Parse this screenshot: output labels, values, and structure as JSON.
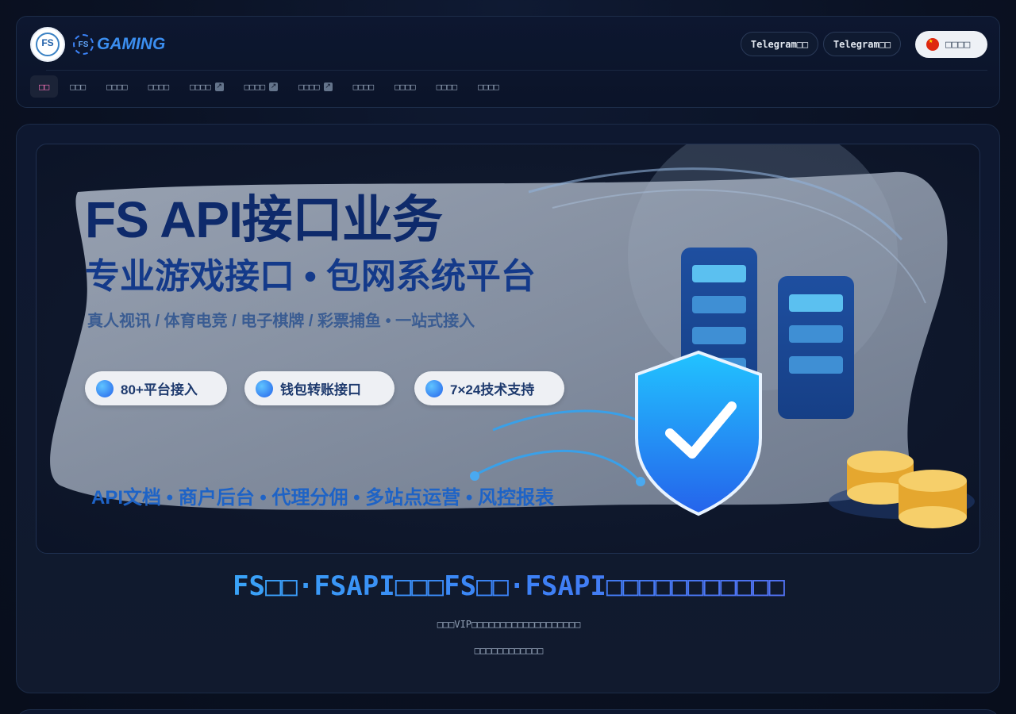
{
  "header": {
    "logo_text": "FS",
    "brand_mark": "FS",
    "brand_word": "GAMING",
    "telegram_buttons": [
      "Telegram□□",
      "Telegram□□"
    ],
    "language_label": "□□□□",
    "language_flag": "china-flag-icon"
  },
  "nav": {
    "items": [
      {
        "label": "□□",
        "active": true,
        "external": false
      },
      {
        "label": "□□□",
        "external": false
      },
      {
        "label": "□□□□",
        "external": false
      },
      {
        "label": "□□□□",
        "external": false
      },
      {
        "label": "□□□□",
        "external": true
      },
      {
        "label": "□□□□",
        "external": true
      },
      {
        "label": "□□□□",
        "external": true
      },
      {
        "label": "□□□□",
        "external": false
      },
      {
        "label": "□□□□",
        "external": false
      },
      {
        "label": "□□□□",
        "external": false
      },
      {
        "label": "□□□□",
        "external": false
      }
    ],
    "external_icon": "↗"
  },
  "banner": {
    "title": "FS API接口业务",
    "subtitle": "专业游戏接口 • 包网系统平台",
    "categories": "真人视讯 / 体育电竞 / 电子棋牌 / 彩票捕鱼 • 一站式接入",
    "pills": [
      "80+平台接入",
      "钱包转账接口",
      "7×24技术支持"
    ],
    "bottom_line": "API文档 • 商户后台 • 代理分佣 • 多站点运营 • 风控报表"
  },
  "hero": {
    "title": "FS□□·FSAPI□□□FS□□·FSAPI□□□□□□□□□□□",
    "line1": "□□□VIP□□□□□□□□□□□□□□□□□□□",
    "line2": "□□□□□□□□□□□□"
  },
  "colors": {
    "accent": "#3b82f6",
    "nav_active": "#f472b6",
    "background": "#0a1122"
  }
}
